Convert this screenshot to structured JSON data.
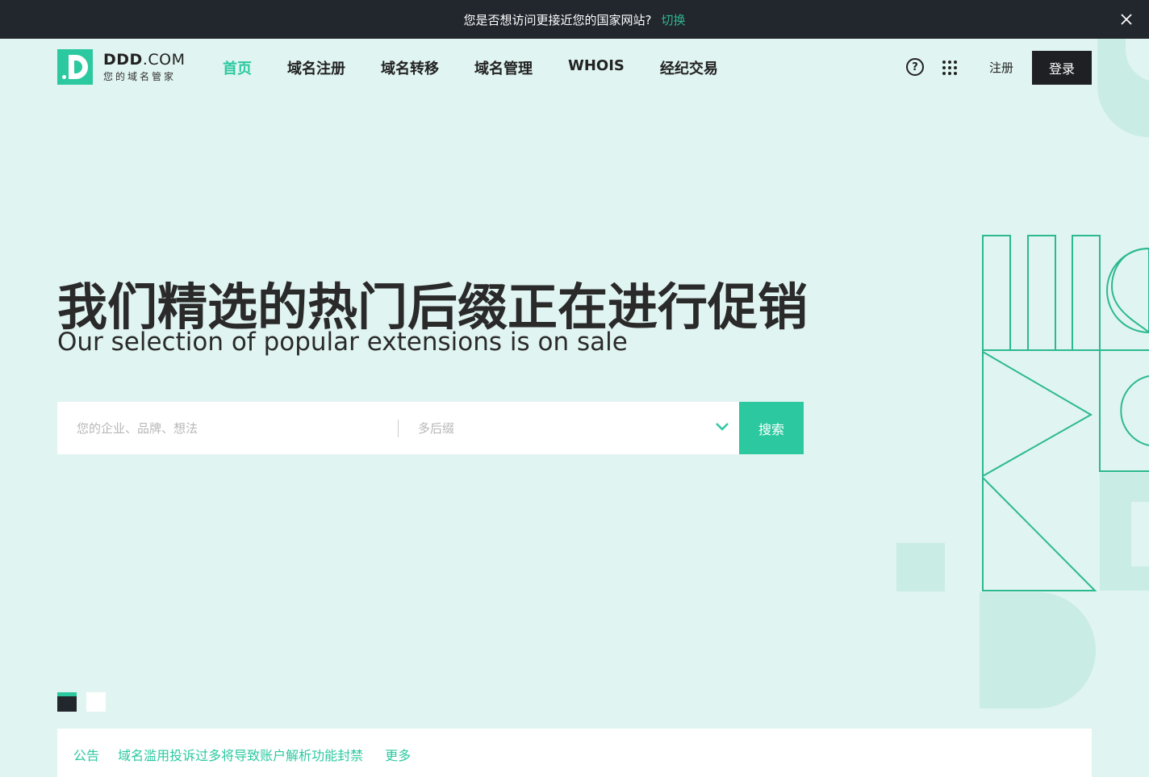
{
  "topbar": {
    "message": "您是否想访问更接近您的国家网站?",
    "switch_label": "切换",
    "close_icon": "close-icon"
  },
  "logo": {
    "title_main": "DDD",
    "title_suffix": ".COM",
    "subtitle": "您的域名管家"
  },
  "nav": {
    "items": [
      {
        "label": "首页",
        "active": true
      },
      {
        "label": "域名注册",
        "active": false
      },
      {
        "label": "域名转移",
        "active": false
      },
      {
        "label": "域名管理",
        "active": false
      },
      {
        "label": "WHOIS",
        "active": false
      },
      {
        "label": "经纪交易",
        "active": false
      }
    ]
  },
  "header_actions": {
    "help_icon": "help-circle-icon",
    "apps_icon": "grid-apps-icon",
    "register_label": "注册",
    "login_label": "登录"
  },
  "hero": {
    "title": "我们精选的热门后缀正在进行促销",
    "subtitle": "Our selection of popular extensions is on sale"
  },
  "search": {
    "input_placeholder": "您的企业、品牌、想法",
    "input_value": "",
    "suffix_placeholder": "多后缀",
    "button_label": "搜索"
  },
  "notice": {
    "prefix": "公告",
    "text": "域名滥用投诉过多将导致账户解析功能封禁",
    "more_label": "更多"
  },
  "colors": {
    "accent": "#2cc9a0",
    "topbar_bg": "#22262d",
    "page_bg": "#e0f4f1",
    "dark_button": "#1f2024"
  }
}
